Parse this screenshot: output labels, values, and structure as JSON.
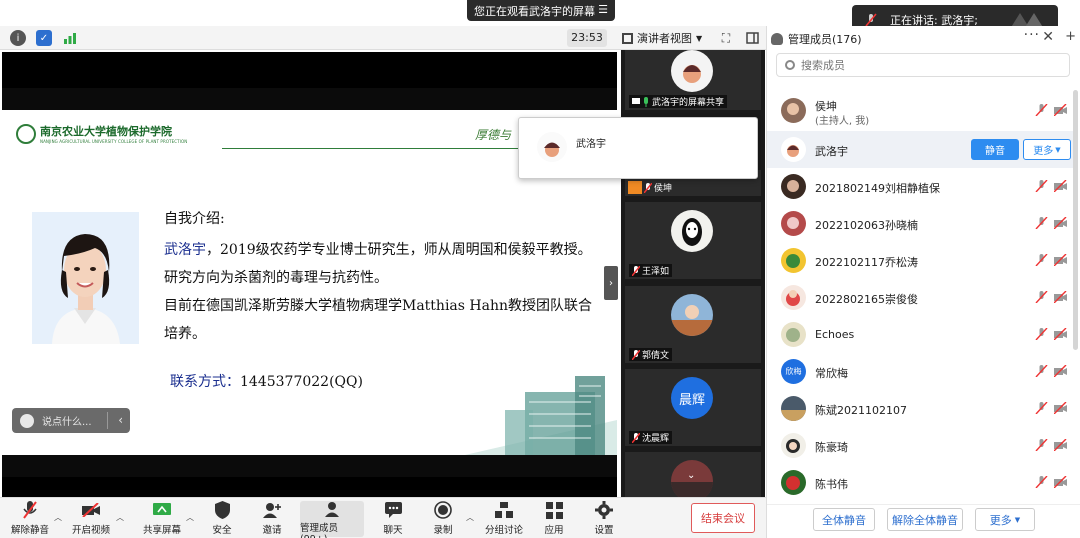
{
  "banner": {
    "text": "您正在观看武洛宇的屏幕",
    "menu_icon": "hamburger-icon"
  },
  "toolbar": {
    "time": "23:53",
    "view_label": "演讲者视图"
  },
  "speaking": {
    "text": "正在讲话: 武洛宇;"
  },
  "slide": {
    "school_cn": "南京农业大学植物保护学院",
    "school_en": "NANJING AGRICULTURAL UNIVERSITY COLLEGE OF PLANT PROTECTION",
    "motto": "厚德与",
    "intro_title": "自我介绍:",
    "name": "武洛宇",
    "line1_rest": "，2019级农药学专业博士研究生，师从周明国和侯毅平教授。",
    "line2": "研究方向为杀菌剂的毒理与抗药性。",
    "line3": "目前在德国凯泽斯劳滕大学植物病理学Matthias Hahn教授团队联合",
    "line4": "培养。",
    "contact_label": "联系方式",
    "contact_value": "1445377022(QQ)"
  },
  "chat_input": {
    "placeholder": "说点什么..."
  },
  "gallery": {
    "tiles": [
      {
        "name": "武洛宇的屏幕共享"
      },
      {
        "name": "侯坤"
      },
      {
        "name": "王泽如"
      },
      {
        "name": "郭倩文"
      },
      {
        "name": "沈晨辉",
        "avatar_text": "晨辉"
      }
    ]
  },
  "popup": {
    "name": "武洛宇"
  },
  "panel": {
    "title": "管理成员(176)",
    "search_placeholder": "搜索成员",
    "mute_label": "静音",
    "more_label": "更多",
    "host_label": "(主持人, 我)",
    "members": [
      {
        "name": "侯坤"
      },
      {
        "name": "武洛宇"
      },
      {
        "name": "2021802149刘相静植保"
      },
      {
        "name": "2022102063孙晓楠"
      },
      {
        "name": "2022102117乔松涛"
      },
      {
        "name": "2022802165崇俊俊"
      },
      {
        "name": "Echoes"
      },
      {
        "name": "常欣梅",
        "avatar_text": "欣梅"
      },
      {
        "name": "陈斌2021102107"
      },
      {
        "name": "陈豪琦"
      },
      {
        "name": "陈书伟"
      }
    ],
    "footer": {
      "mute_all": "全体静音",
      "unmute_all": "解除全体静音",
      "more": "更多"
    }
  },
  "controls": {
    "unmute": "解除静音",
    "video": "开启视频",
    "share": "共享屏幕",
    "security": "安全",
    "invite": "邀请",
    "manage": "管理成员(99+)",
    "chat": "聊天",
    "record": "录制",
    "breakout": "分组讨论",
    "apps": "应用",
    "settings": "设置",
    "end": "结束会议"
  },
  "colors": {
    "accent": "#2d8cf0",
    "danger": "#d63b3b",
    "slide_green": "#2f7d3a",
    "slide_blue": "#1b2f8f"
  }
}
